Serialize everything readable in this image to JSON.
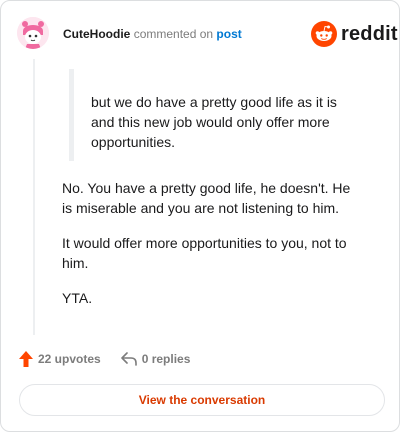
{
  "header": {
    "username": "CuteHoodie",
    "action_text": "commented on",
    "post_link": "post",
    "brand": "reddit"
  },
  "quote": {
    "text": "but we do have a pretty good life as it is and this new job would only offer more opportunities."
  },
  "comment": {
    "paragraphs": [
      "No. You have a pretty good life, he doesn't. He is miserable and you are not listening to him.",
      "It would offer more opportunities to you, not to him.",
      "YTA."
    ]
  },
  "footer": {
    "upvotes_label": "22 upvotes",
    "replies_label": "0 replies",
    "view_conversation_label": "View the conversation"
  },
  "colors": {
    "reddit_orange": "#ff4500",
    "upvote_orange": "#ff4500",
    "link_blue": "#0079d3",
    "cta_text": "#d93a00"
  }
}
